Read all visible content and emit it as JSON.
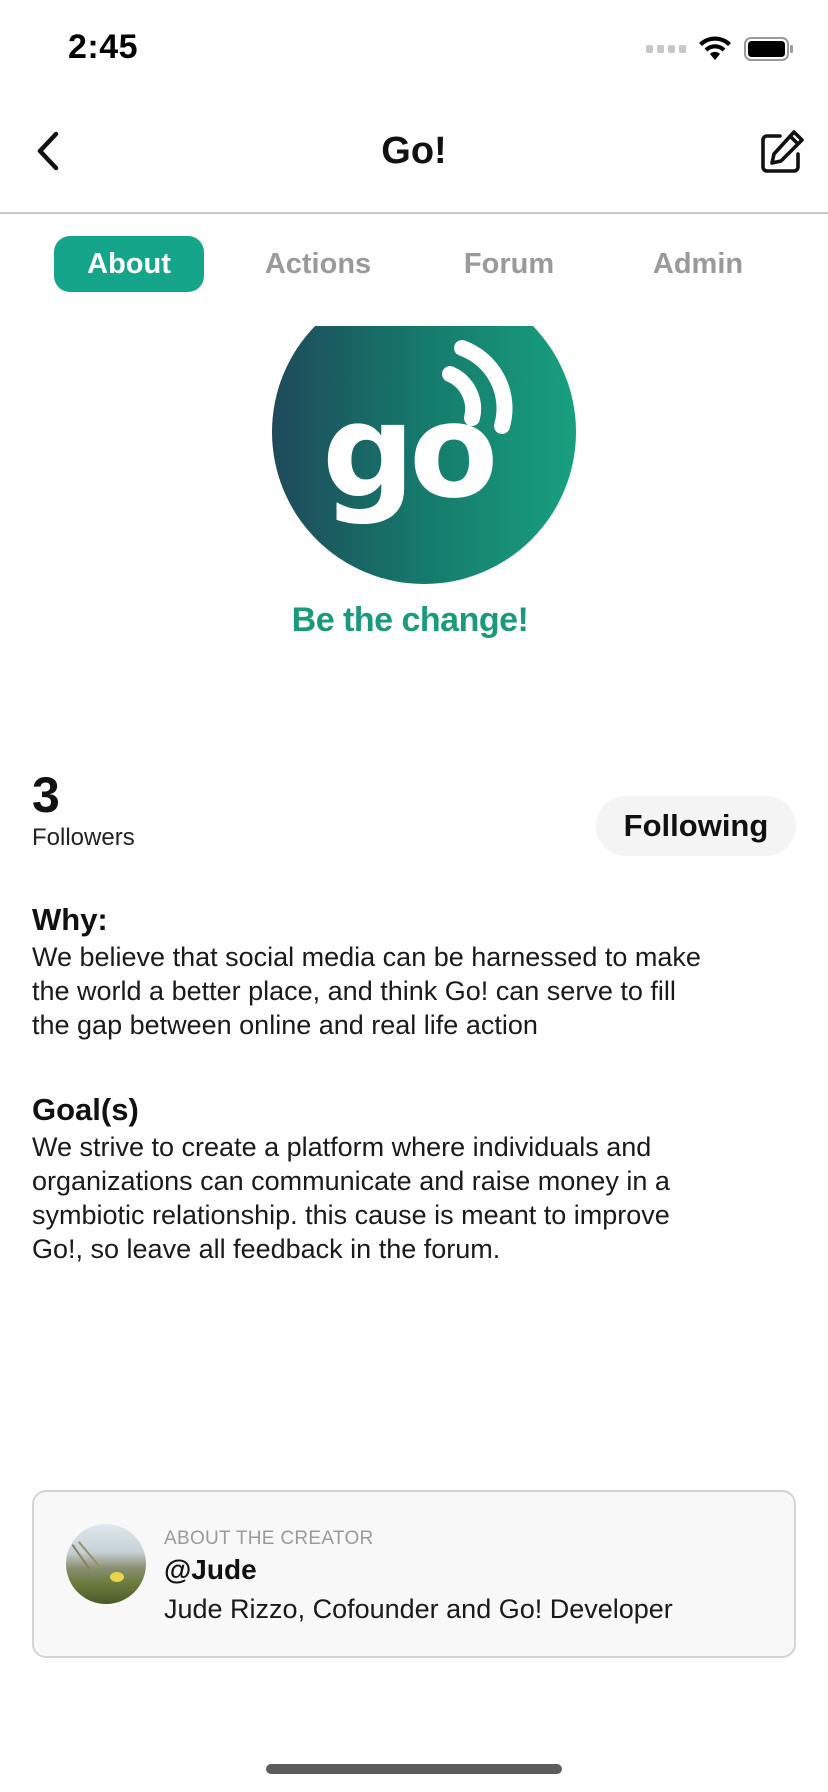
{
  "status_bar": {
    "time": "2:45"
  },
  "nav": {
    "title": "Go!"
  },
  "tabs": [
    {
      "label": "About",
      "active": true
    },
    {
      "label": "Actions",
      "active": false
    },
    {
      "label": "Forum",
      "active": false
    },
    {
      "label": "Admin",
      "active": false
    }
  ],
  "logo": {
    "text": "go",
    "tagline": "Be the change!",
    "colors": {
      "start": "#1e4a5a",
      "end": "#18a07e"
    }
  },
  "followers": {
    "count": "3",
    "label": "Followers"
  },
  "follow_button": {
    "label": "Following"
  },
  "why": {
    "title": "Why:",
    "lines": [
      "We believe that social media can be harnessed to make",
      "the world a better place, and think Go! can serve to fill",
      "the gap between online and real life action"
    ]
  },
  "goals": {
    "title": "Goal(s)",
    "lines": [
      "We strive to create a platform where individuals and",
      "organizations can communicate and raise money in a",
      "symbiotic relationship. this cause is meant to improve",
      "Go!, so leave all feedback in the forum."
    ]
  },
  "creator": {
    "eyebrow": "ABOUT THE CREATOR",
    "handle": "@Jude",
    "description": "Jude Rizzo, Cofounder and Go! Developer"
  },
  "colors": {
    "accent": "#14a58a",
    "tagline": "#1a9a7c"
  }
}
